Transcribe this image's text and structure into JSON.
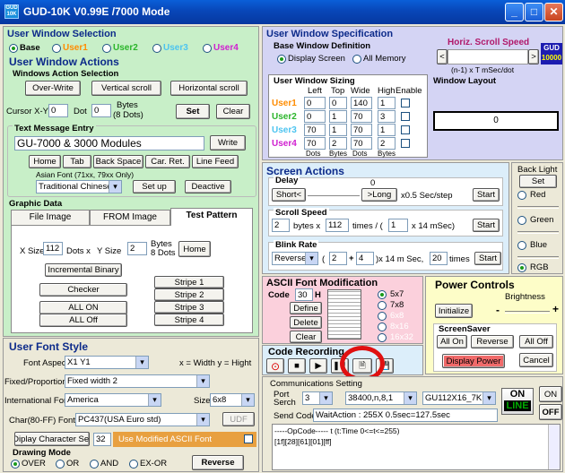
{
  "window": {
    "title": "GUD-10K V0.99E /7000 Mode"
  },
  "uws": {
    "title": "User Window Selection",
    "options": [
      "Base",
      "User1",
      "User2",
      "User3",
      "User4"
    ]
  },
  "uwa": {
    "title": "User Window Actions"
  },
  "wasel": {
    "title": "Windows Action Selection",
    "overwrite": "Over-Write",
    "vscroll": "Vertical scroll",
    "hscroll": "Horizontal scroll"
  },
  "cursor": {
    "label": "Cursor X-Y",
    "x": "0",
    "dot": "Dot",
    "y": "0",
    "bytes": "Bytes",
    "dots8": "(8 Dots)",
    "set": "Set",
    "clear": "Clear"
  },
  "tme": {
    "title": "Text Message Entry",
    "text": "GU-7000 & 3000 Modules",
    "write": "Write",
    "home": "Home",
    "tab": "Tab",
    "backspace": "Back Space",
    "carret": "Car. Ret.",
    "linefeed": "Line Feed",
    "asian_label": "Asian Font (71xx, 79xx Only)",
    "asian_value": "Traditional Chinese",
    "setup": "Set up",
    "deactive": "Deactive"
  },
  "gd": {
    "title": "Graphic Data",
    "tabs": [
      "File Image",
      "FROM Image",
      "Test Pattern"
    ],
    "xsize_label": "X Size",
    "xsize": "112",
    "dots_x": "Dots x",
    "ysize_label": "Y Size",
    "ysize": "2",
    "bytes": "Bytes",
    "dots8": "8 Dots",
    "home": "Home",
    "incbin": "Incremental Binary",
    "checker": "Checker",
    "allon": "ALL ON",
    "alloff": "ALL Off",
    "stripes": [
      "Stripe 1",
      "Stripe 2",
      "Stripe 3",
      "Stripe 4"
    ]
  },
  "ufs": {
    "title": "User Font Style",
    "aspect_label": "Font Aspect:",
    "aspect": "X1 Y1",
    "aspect_note": "x = Width  y = Hight",
    "fp_label": "Fixed/Proportional:",
    "fp": "Fixed width 2",
    "intl_label": "International Font:",
    "intl": "America",
    "size_label": "Size",
    "size": "6x8",
    "char_label": "Char(80-FF) Font:",
    "char": "PC437(USA Euro std)",
    "udf": "UDF",
    "dispset": "Diplay Character Set",
    "dispset_num": "32",
    "use_mod": "Use Modified ASCII Font"
  },
  "draw": {
    "title": "Drawing Mode",
    "modes": [
      "OVER",
      "OR",
      "AND",
      "EX-OR"
    ],
    "reverse": "Reverse"
  },
  "uwspec": {
    "title": "User Window Specification",
    "bwd": "Base Window Definition",
    "display": "Display Screen",
    "allmem": "All Memory",
    "hscroll": "Horiz. Scroll Speed",
    "hs_formula": "(n-1) x T mSec/dot",
    "logo1": "GUD",
    "logo2": "10000"
  },
  "uwsz": {
    "title": "User Window Sizing",
    "cols": [
      "Left",
      "Top",
      "Wide",
      "High",
      "Enable"
    ],
    "units": [
      "Dots",
      "Bytes",
      "Dots",
      "Bytes"
    ],
    "rows": [
      {
        "name": "User1",
        "left": "0",
        "top": "0",
        "wide": "140",
        "high": "1"
      },
      {
        "name": "User2",
        "left": "0",
        "top": "1",
        "wide": "70",
        "high": "3"
      },
      {
        "name": "User3",
        "left": "70",
        "top": "1",
        "wide": "70",
        "high": "1"
      },
      {
        "name": "User4",
        "left": "70",
        "top": "2",
        "wide": "70",
        "high": "2"
      }
    ]
  },
  "layout": {
    "title": "Window Layout",
    "value": "0"
  },
  "sa": {
    "title": "Screen Actions",
    "delay": "Delay",
    "delay_val": "0",
    "short": "Short<",
    "long": ">Long",
    "step": "x0.5 Sec/step",
    "start": "Start",
    "sspeed": "Scroll Speed",
    "ss_bytes": "2",
    "bytes_x": "bytes x",
    "ss_times": "112",
    "times": "times / (",
    "ss_n": "1",
    "x14": "x 14 mSec)",
    "brate": "Blink Rate",
    "bmode": "Reverse",
    "b_open": "(",
    "b_a": "2",
    "plus": "+",
    "b_b": "4",
    "b_mid": ")x 14 m Sec,",
    "b_times": "20",
    "times2": "times"
  },
  "bl": {
    "title": "Back Light",
    "set": "Set",
    "red": "Red",
    "green": "Green",
    "blue": "Blue",
    "rgb": "RGB"
  },
  "afm": {
    "title": "ASCII Font Modification",
    "code": "Code",
    "code_val": "30",
    "h": "H",
    "define": "Define",
    "delete": "Delete",
    "clear": "Clear",
    "sizes": [
      "5x7",
      "7x8",
      "6x8",
      "8x16",
      "16x32"
    ]
  },
  "pc": {
    "title": "Power Controls",
    "bright": "Brightness",
    "init": "Initialize",
    "minus": "-",
    "plus": "+"
  },
  "ss": {
    "title": "ScreenSaver",
    "allon": "All On",
    "reverse": "Reverse",
    "alloff": "All Off",
    "dp": "Display Power",
    "cancel": "Cancel"
  },
  "cr": {
    "title": "Code Recording"
  },
  "comm": {
    "title": "Communications Setting",
    "port": "Port",
    "serch": "Serch",
    "port_val": "3",
    "baud": "38400,n,8,1",
    "model": "GU112X16_7K",
    "on": "ON",
    "off": "OFF",
    "online_on": "ON",
    "online_line": "LINE",
    "sendcode": "Send Code",
    "wait": "WaitAction : 255X 0.5sec=127.5sec",
    "log1": "-----OpCode----- t  (t:Time 0<=t<=255)",
    "log2": "[1f][28][61][01][ff]"
  }
}
